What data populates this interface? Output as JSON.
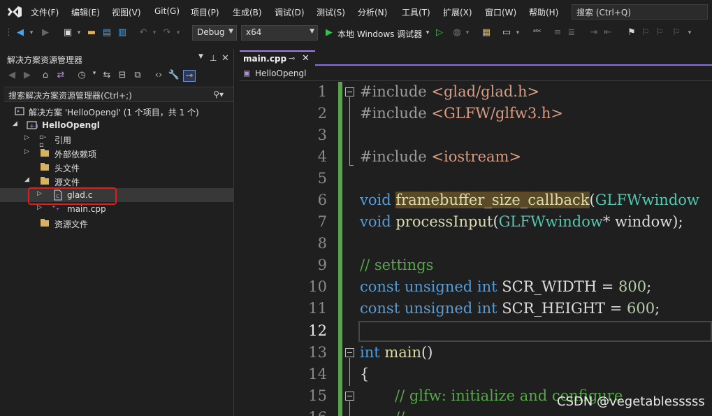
{
  "menubar": {
    "items": [
      "文件(F)",
      "编辑(E)",
      "视图(V)",
      "Git(G)",
      "项目(P)",
      "生成(B)",
      "调试(D)",
      "测试(S)",
      "分析(N)",
      "工具(T)",
      "扩展(X)",
      "窗口(W)",
      "帮助(H)"
    ],
    "search_placeholder": "搜索 (Ctrl+Q)"
  },
  "toolbar": {
    "config": "Debug",
    "platform": "x64",
    "run_label": "本地 Windows 调试器"
  },
  "solution_explorer": {
    "title": "解决方案资源管理器",
    "search_placeholder": "搜索解决方案资源管理器(Ctrl+;)",
    "solution_label": "解决方案 'HelloOpengl' (1 个项目，共 1 个)",
    "project": "HelloOpengl",
    "nodes": [
      "引用",
      "外部依赖项",
      "头文件",
      "源文件",
      "glad.c",
      "main.cpp",
      "资源文件"
    ]
  },
  "editor": {
    "tab": "main.cpp",
    "nav_scope": "HelloOpengl",
    "line_numbers": [
      "1",
      "2",
      "3",
      "4",
      "5",
      "6",
      "7",
      "8",
      "9",
      "10",
      "11",
      "12",
      "13",
      "14",
      "15",
      "16"
    ],
    "current_line": "12",
    "code": {
      "l1_a": "#include ",
      "l1_b": "<glad/glad.h>",
      "l2_a": "#include ",
      "l2_b": "<GLFW/glfw3.h>",
      "l4_a": "#include ",
      "l4_b": "<iostream>",
      "l6_a": "void ",
      "l6_b": "framebuffer_size_callback",
      "l6_c": "(",
      "l6_d": "GLFWwindow",
      "l7_a": "void ",
      "l7_b": "processInput",
      "l7_c": "(",
      "l7_d": "GLFWwindow",
      "l7_e": "* window);",
      "l9": "// settings",
      "l10_a": "const ",
      "l10_b": "unsigned ",
      "l10_c": "int ",
      "l10_d": "SCR_WIDTH = ",
      "l10_e": "800",
      "l10_f": ";",
      "l11_a": "const ",
      "l11_b": "unsigned ",
      "l11_c": "int ",
      "l11_d": "SCR_HEIGHT = ",
      "l11_e": "600",
      "l11_f": ";",
      "l13_a": "int ",
      "l13_b": "main",
      "l13_c": "()",
      "l14": "{",
      "l15": "// glfw: initialize and configure",
      "l16": "// ---"
    }
  },
  "watermark": "CSDN @vegetablesssss"
}
